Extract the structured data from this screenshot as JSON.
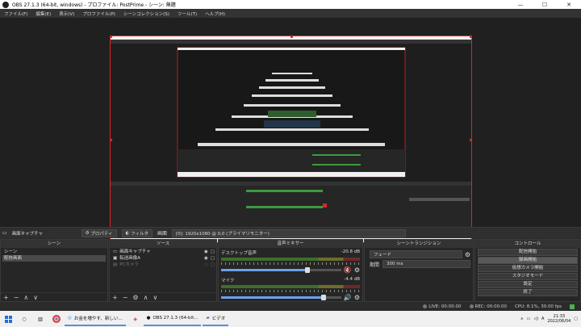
{
  "window": {
    "title": "OBS 27.1.3 (64-bit, windows) - プロファイル: PostPrime - シーン: 無題",
    "min": "—",
    "max": "☐",
    "close": "✕"
  },
  "menu": [
    "ファイル(F)",
    "編集(E)",
    "表示(V)",
    "プロファイル(P)",
    "シーンコレクション(S)",
    "ツール(T)",
    "ヘルプ(H)"
  ],
  "source_toolbar": {
    "selected": "画面キャプチャ",
    "properties": "プロパティ",
    "filters": "フィルタ",
    "display_label": "画面",
    "display_value": "[0]: 1920x1080 @ 0,0 (プライマリモニター)"
  },
  "scenes": {
    "header": "シーン",
    "items": [
      "シーン",
      "配信画面"
    ],
    "selected_index": 1
  },
  "sources": {
    "header": "ソース",
    "items": [
      "画面キャプチャ",
      "転送画像A",
      "PCカメラ"
    ]
  },
  "mixer": {
    "header": "音声ミキサー",
    "channels": [
      {
        "name": "デスクトップ音声",
        "level": "-20.8 dB",
        "fader": 0.72,
        "muted": true
      },
      {
        "name": "マイク",
        "level": "-4.4 dB",
        "fader": 0.85,
        "muted": false
      }
    ]
  },
  "transitions": {
    "header": "シーントランジション",
    "type": "フェード",
    "duration_label": "期間",
    "duration": "300 ms"
  },
  "controls": {
    "header": "コントロール",
    "buttons": [
      "配信開始",
      "録画開始",
      "仮想カメラ開始",
      "スタジオモード",
      "設定",
      "終了"
    ],
    "hover_index": 1
  },
  "status": {
    "live": "LIVE: 00:00:00",
    "rec": "REC: 00:00:00",
    "cpu": "CPU: 8.1%, 30.00 fps"
  },
  "taskbar": {
    "items": [
      "お金を増やす、新しい...",
      "OBS 27.1.3 (64-bit...",
      "ビデオ"
    ],
    "time": "21:33",
    "date": "2022/06/04",
    "ime": "A"
  },
  "colors": {
    "accent": "#e0242a",
    "taskbar": "#f0f0f0",
    "panel": "#262626"
  }
}
